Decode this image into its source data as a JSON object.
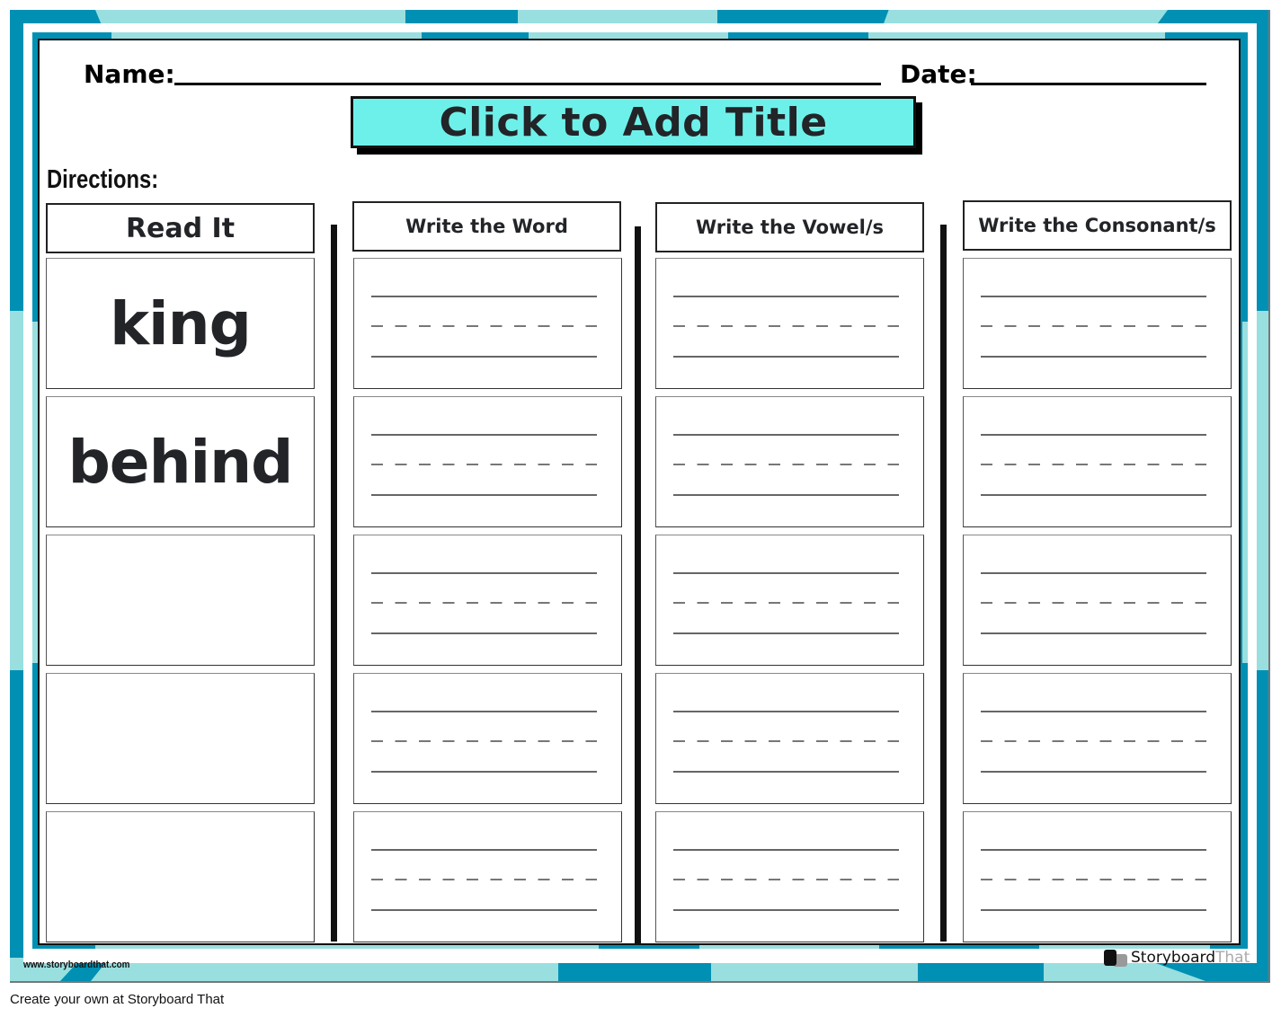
{
  "header": {
    "name_label": "Name:",
    "date_label": "Date:",
    "title": "Click to Add Title",
    "directions_label": "Directions:"
  },
  "columns": [
    {
      "id": "read",
      "label": "Read It"
    },
    {
      "id": "word",
      "label": "Write the Word"
    },
    {
      "id": "vowel",
      "label": "Write the Vowel/s"
    },
    {
      "id": "consonant",
      "label": "Write the Consonant/s"
    }
  ],
  "rows": [
    {
      "read_word": "king"
    },
    {
      "read_word": "behind"
    },
    {
      "read_word": ""
    },
    {
      "read_word": ""
    },
    {
      "read_word": ""
    }
  ],
  "watermark": {
    "site": "www.storyboardthat.com",
    "brand_primary": "Storyboard",
    "brand_secondary": "That"
  },
  "footer": {
    "text": "Create your own at Storyboard That"
  },
  "colors": {
    "frame_dark": "#0090b3",
    "frame_light": "#99dfe0",
    "title_fill": "#6ef0ea",
    "text_dark": "#222428"
  }
}
